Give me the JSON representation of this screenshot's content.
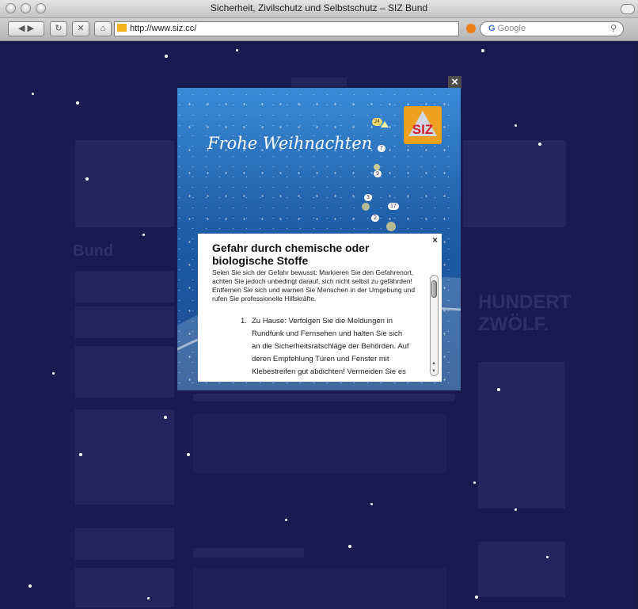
{
  "window": {
    "title": "Sicherheit, Zivilschutz und Selbstschutz – SIZ Bund"
  },
  "toolbar": {
    "url": "http://www.siz.cc/",
    "search_placeholder": "Google"
  },
  "background": {
    "section_title": "Bund",
    "headline_1": "HUNDERT",
    "headline_2": "ZWÖLF."
  },
  "modal": {
    "greeting": "Frohe Weihnachten",
    "logo": "SIZ",
    "tree_numbers": [
      "24",
      "7",
      "9",
      "3",
      "17",
      "2"
    ],
    "dialog": {
      "title": "Gefahr durch chemische oder biologische Stoffe",
      "intro": "Seien Sie sich der Gefahr bewusst: Markieren Sie den Gefahrenort, achten Sie jedoch unbedingt darauf, sich nicht selbst zu gefährden! Entfernen Sie sich und warnen Sie Menschen in der Umgebung und rufen Sie professionelle Hilfskräfte.",
      "items": [
        {
          "number": "1.",
          "text": "Zu Hause: Verfolgen Sie die Meldungen in Rundfunk und Fernsehen und halten Sie sich an die Sicherheitsratschläge der Behörden. Auf deren Empfehlung Türen und Fenster mit Klebestreifen gut abdichten! Vermeiden Sie es"
        }
      ]
    }
  },
  "colors": {
    "page_bg": "#1c1a52",
    "modal_blue": "#2a6fbf",
    "logo_orange": "#f0a020",
    "logo_red": "#d2202a"
  }
}
